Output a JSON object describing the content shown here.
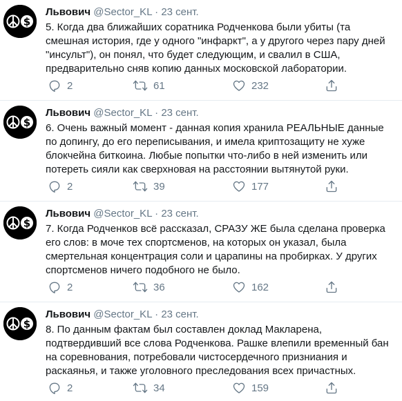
{
  "tweets": [
    {
      "name": "Львович",
      "handle": "@Sector_KL",
      "dot": "·",
      "date": "23 сент.",
      "text": "5. Когда два ближайших соратника Родченкова были убиты (та смешная история, где у одного \"инфаркт\", а у другого через пару дней \"инсульт\"), он понял, что будет следующим, и свалил в США, предварительно сняв копию данных московской лаборатории.",
      "replies": "2",
      "retweets": "61",
      "likes": "232"
    },
    {
      "name": "Львович",
      "handle": "@Sector_KL",
      "dot": "·",
      "date": "23 сент.",
      "text": "6. Очень важный момент - данная копия хранила РЕАЛЬНЫЕ данные по допингу, до его переписывания, и имела криптозащиту не хуже блокчейна биткоина. Любые попытки что-либо в ней изменить или потереть сияли как сверхновая на расстоянии вытянутой руки.",
      "replies": "2",
      "retweets": "39",
      "likes": "177"
    },
    {
      "name": "Львович",
      "handle": "@Sector_KL",
      "dot": "·",
      "date": "23 сент.",
      "text": "7. Когда Родченков всё рассказал, СРАЗУ ЖЕ была сделана проверка его слов: в моче тех спортсменов, на которых он указал, была смертельная концентрация соли и царапины на пробирках. У других спортсменов ничего подобного не было.",
      "replies": "2",
      "retweets": "36",
      "likes": "162"
    },
    {
      "name": "Львович",
      "handle": "@Sector_KL",
      "dot": "·",
      "date": "23 сент.",
      "text": "8. По данным фактам был составлен доклад Макларена, подтвердивший все слова Родченкова. Рашке влепили временный бан на соревнования, потребовали чистосердечного призниания и раскаянья, и также уголовного преследования всех причастных.",
      "replies": "2",
      "retweets": "34",
      "likes": "159"
    }
  ],
  "icons": {
    "avatar": "peace-dollar-avatar",
    "reply": "reply-icon",
    "retweet": "retweet-icon",
    "like": "heart-icon",
    "share": "share-icon"
  },
  "colors": {
    "text": "#14171a",
    "secondary": "#657786",
    "divider": "#e6ecf0"
  }
}
